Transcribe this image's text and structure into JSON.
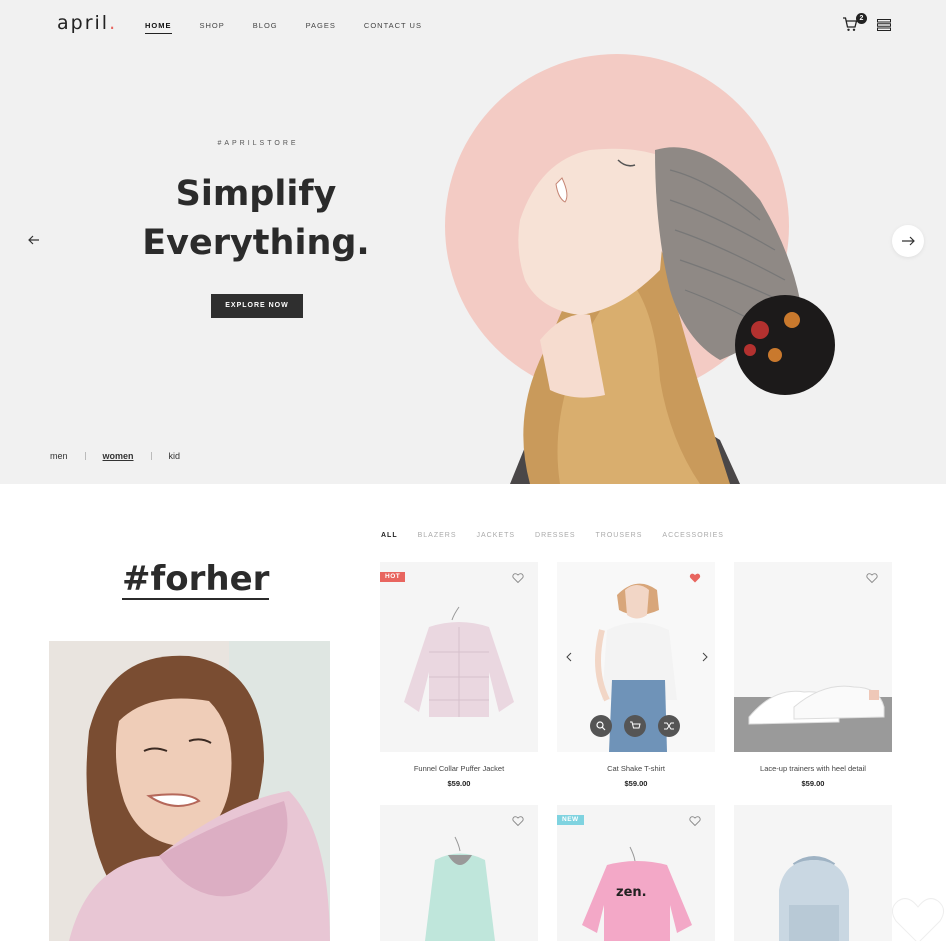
{
  "brand": {
    "logo_text": "april",
    "logo_dot": ".",
    "accent": "#e8655f"
  },
  "nav": {
    "items": [
      {
        "label": "HOME",
        "active": true
      },
      {
        "label": "SHOP",
        "active": false
      },
      {
        "label": "BLOG",
        "active": false
      },
      {
        "label": "PAGES",
        "active": false
      },
      {
        "label": "CONTACT US",
        "active": false
      }
    ],
    "cart_count": "2",
    "icons": [
      "cart-icon",
      "menu-icon"
    ]
  },
  "hero": {
    "tag": "#APRILSTORE",
    "title_line1": "Simplify",
    "title_line2": "Everything.",
    "button_label": "EXPLORE NOW",
    "circle_color": "#f3cbc4",
    "gender_links": [
      {
        "label": "men",
        "active": false
      },
      {
        "label": "women",
        "active": true
      },
      {
        "label": "kid",
        "active": false
      }
    ]
  },
  "collection": {
    "title": "#forher"
  },
  "filters": {
    "items": [
      {
        "label": "ALL",
        "active": true
      },
      {
        "label": "BLAZERS",
        "active": false
      },
      {
        "label": "JACKETS",
        "active": false
      },
      {
        "label": "DRESSES",
        "active": false
      },
      {
        "label": "TROUSERS",
        "active": false
      },
      {
        "label": "ACCESSORIES",
        "active": false
      }
    ]
  },
  "products": [
    {
      "name": "Funnel Collar Puffer Jacket",
      "price": "$59.00",
      "badge": "HOT",
      "favorited": false
    },
    {
      "name": "Cat Shake T-shirt",
      "price": "$59.00",
      "badge": "",
      "favorited": true
    },
    {
      "name": "Lace-up trainers with heel detail",
      "price": "$59.00",
      "badge": "",
      "favorited": false
    },
    {
      "name": "",
      "price": "",
      "badge": "",
      "favorited": false
    },
    {
      "name": "",
      "price": "",
      "badge": "NEW",
      "favorited": false
    },
    {
      "name": "",
      "price": "",
      "badge": "",
      "favorited": false
    }
  ],
  "product_art": {
    "zen_text": "zen."
  }
}
